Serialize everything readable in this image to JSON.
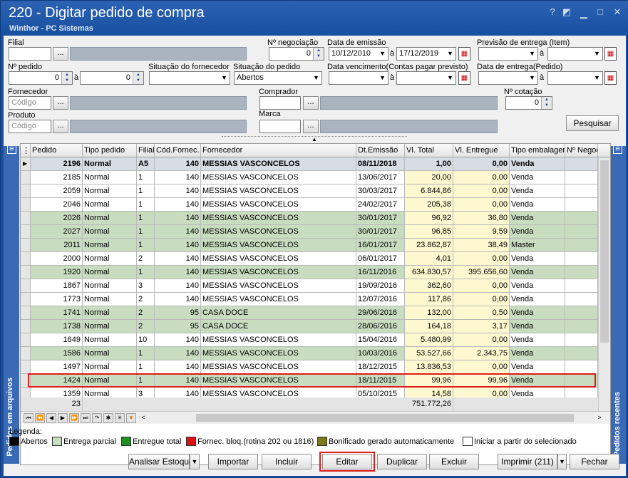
{
  "window": {
    "title": "220 - Digitar pedido de compra",
    "subtitle": "Winthor - PC Sistemas",
    "controls": [
      "?",
      "◩",
      "▭",
      "□",
      "✕"
    ]
  },
  "filters": {
    "filial_label": "Filial",
    "negociacao_label": "Nº negociação",
    "negociacao_value": "0",
    "emissao_label": "Data de emissão",
    "emissao_from": "10/12/2010",
    "emissao_to": "17/12/2019",
    "a": "à",
    "previsao_label": "Previsão  de entrega (Item)",
    "pedido_label": "Nº pedido",
    "pedido_from": "0",
    "pedido_to": "0",
    "sit_fornecedor_label": "Situação do fornecedor",
    "sit_pedido_label": "Situação do pedido",
    "sit_pedido_value": "Abertos",
    "vencimento_label": "Data vencimento(Contas pagar previsto)",
    "entrega_pedido_label": "Data de entrega(Pedido)",
    "fornecedor_label": "Fornecedor",
    "fornecedor_placeholder": "Código",
    "comprador_label": "Comprador",
    "cotacao_label": "Nº cotação",
    "cotacao_value": "0",
    "produto_label": "Produto",
    "produto_placeholder": "Código",
    "marca_label": "Marca",
    "pesquisar": "Pesquisar",
    "dots": "..."
  },
  "sidebars": {
    "left": "Pedidos em arquivos",
    "right": "Pedidos recentes"
  },
  "grid": {
    "columns": [
      "Pedido",
      "Tipo pedido",
      "Filial",
      "Cód.Fornec.",
      "Fornecedor",
      "Dt.Emissão",
      "Vl. Total",
      "Vl. Entregue",
      "Tipo embalagem",
      "Nº Negoc"
    ],
    "rows": [
      {
        "pedido": "2196",
        "tipo": "Normal",
        "filial": "A5",
        "cod": "140",
        "fornecedor": "MESSIAS VASCONCELOS",
        "data": "08/11/2018",
        "total": "1,00",
        "entregue": "0,00",
        "emb": "Venda",
        "style": "sel"
      },
      {
        "pedido": "2185",
        "tipo": "Normal",
        "filial": "1",
        "cod": "140",
        "fornecedor": "MESSIAS VASCONCELOS",
        "data": "13/06/2017",
        "total": "20,00",
        "entregue": "0,00",
        "emb": "Venda",
        "style": "white"
      },
      {
        "pedido": "2059",
        "tipo": "Normal",
        "filial": "1",
        "cod": "140",
        "fornecedor": "MESSIAS VASCONCELOS",
        "data": "30/03/2017",
        "total": "6.844,86",
        "entregue": "0,00",
        "emb": "Venda",
        "style": "white"
      },
      {
        "pedido": "2046",
        "tipo": "Normal",
        "filial": "1",
        "cod": "140",
        "fornecedor": "MESSIAS VASCONCELOS",
        "data": "24/02/2017",
        "total": "205,38",
        "entregue": "0,00",
        "emb": "Venda",
        "style": "white"
      },
      {
        "pedido": "2026",
        "tipo": "Normal",
        "filial": "1",
        "cod": "140",
        "fornecedor": "MESSIAS VASCONCELOS",
        "data": "30/01/2017",
        "total": "96,92",
        "entregue": "36,80",
        "emb": "Venda",
        "style": "green"
      },
      {
        "pedido": "2027",
        "tipo": "Normal",
        "filial": "1",
        "cod": "140",
        "fornecedor": "MESSIAS VASCONCELOS",
        "data": "30/01/2017",
        "total": "96,85",
        "entregue": "9,59",
        "emb": "Venda",
        "style": "green"
      },
      {
        "pedido": "2011",
        "tipo": "Normal",
        "filial": "1",
        "cod": "140",
        "fornecedor": "MESSIAS VASCONCELOS",
        "data": "16/01/2017",
        "total": "23.862,87",
        "entregue": "38,49",
        "emb": "Master",
        "style": "green"
      },
      {
        "pedido": "2000",
        "tipo": "Normal",
        "filial": "2",
        "cod": "140",
        "fornecedor": "MESSIAS VASCONCELOS",
        "data": "06/01/2017",
        "total": "4,01",
        "entregue": "0,00",
        "emb": "Venda",
        "style": "white"
      },
      {
        "pedido": "1920",
        "tipo": "Normal",
        "filial": "1",
        "cod": "140",
        "fornecedor": "MESSIAS VASCONCELOS",
        "data": "16/11/2016",
        "total": "634.830,57",
        "entregue": "395.656,60",
        "emb": "Venda",
        "style": "green"
      },
      {
        "pedido": "1867",
        "tipo": "Normal",
        "filial": "3",
        "cod": "140",
        "fornecedor": "MESSIAS VASCONCELOS",
        "data": "19/09/2016",
        "total": "362,60",
        "entregue": "0,00",
        "emb": "Venda",
        "style": "white"
      },
      {
        "pedido": "1773",
        "tipo": "Normal",
        "filial": "2",
        "cod": "140",
        "fornecedor": "MESSIAS VASCONCELOS",
        "data": "12/07/2016",
        "total": "117,86",
        "entregue": "0,00",
        "emb": "Venda",
        "style": "white"
      },
      {
        "pedido": "1741",
        "tipo": "Normal",
        "filial": "2",
        "cod": "95",
        "fornecedor": "CASA DOCE",
        "data": "29/06/2016",
        "total": "132,00",
        "entregue": "0,50",
        "emb": "Venda",
        "style": "green"
      },
      {
        "pedido": "1738",
        "tipo": "Normal",
        "filial": "2",
        "cod": "95",
        "fornecedor": "CASA DOCE",
        "data": "28/06/2016",
        "total": "164,18",
        "entregue": "3,17",
        "emb": "Venda",
        "style": "green"
      },
      {
        "pedido": "1649",
        "tipo": "Normal",
        "filial": "10",
        "cod": "140",
        "fornecedor": "MESSIAS VASCONCELOS",
        "data": "15/04/2016",
        "total": "5.480,99",
        "entregue": "0,00",
        "emb": "Venda",
        "style": "white"
      },
      {
        "pedido": "1586",
        "tipo": "Normal",
        "filial": "1",
        "cod": "140",
        "fornecedor": "MESSIAS VASCONCELOS",
        "data": "10/03/2016",
        "total": "53.527,66",
        "entregue": "2.343,75",
        "emb": "Venda",
        "style": "green"
      },
      {
        "pedido": "1497",
        "tipo": "Normal",
        "filial": "1",
        "cod": "140",
        "fornecedor": "MESSIAS VASCONCELOS",
        "data": "18/12/2015",
        "total": "13.836,53",
        "entregue": "0,00",
        "emb": "Venda",
        "style": "white"
      },
      {
        "pedido": "1424",
        "tipo": "Normal",
        "filial": "1",
        "cod": "140",
        "fornecedor": "MESSIAS VASCONCELOS",
        "data": "18/11/2015",
        "total": "99,96",
        "entregue": "99,96",
        "emb": "Venda",
        "style": "green"
      },
      {
        "pedido": "1359",
        "tipo": "Normal",
        "filial": "3",
        "cod": "140",
        "fornecedor": "MESSIAS VASCONCELOS",
        "data": "05/10/2015",
        "total": "14,58",
        "entregue": "0,00",
        "emb": "Venda",
        "style": "white"
      }
    ],
    "footer_count": "23",
    "footer_total": "751.772,26"
  },
  "legend": {
    "title": "Legenda:",
    "items": [
      {
        "label": "Abertos",
        "color": "#000000"
      },
      {
        "label": "Entrega parcial",
        "color": "#c8ddc0"
      },
      {
        "label": "Entregue total",
        "color": "#1f8f1f"
      },
      {
        "label": "Fornec. bloq.(rotina 202 ou 1816)",
        "color": "#e01010"
      },
      {
        "label": "Bonificado gerado automaticamente",
        "color": "#7a7a1a"
      }
    ],
    "checkbox_label": "Iniciar a partir do selecionado"
  },
  "buttons": {
    "analisar": "Analisar Estoque",
    "importar": "Importar",
    "incluir": "Incluir",
    "editar": "Editar",
    "duplicar": "Duplicar",
    "excluir": "Excluir",
    "imprimir": "Imprimir (211)",
    "fechar": "Fechar"
  }
}
